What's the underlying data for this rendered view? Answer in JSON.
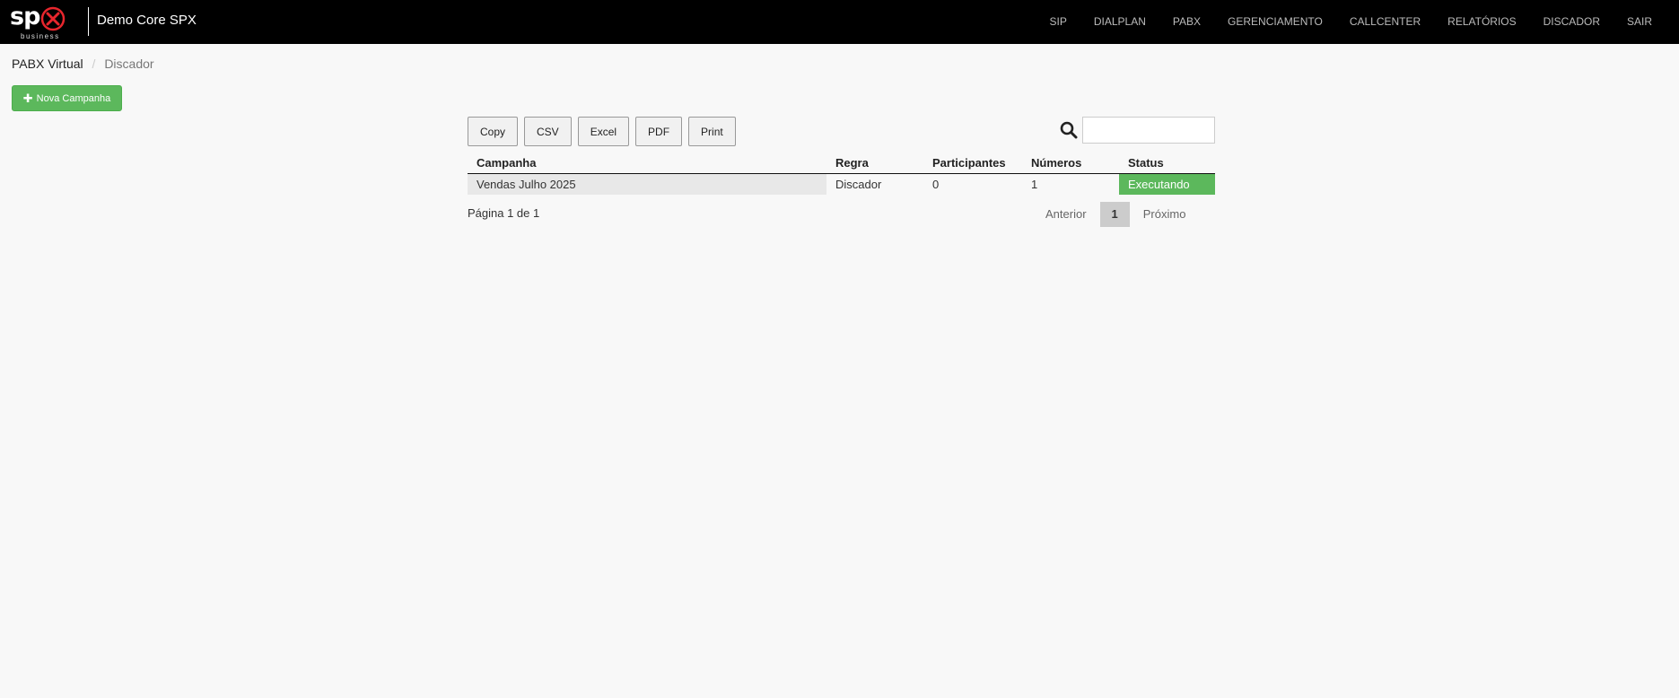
{
  "navbar": {
    "logo_text": "sp",
    "logo_subtext": "business",
    "brand_title": "Demo Core SPX",
    "menu": [
      "SIP",
      "DIALPLAN",
      "PABX",
      "GERENCIAMENTO",
      "CALLCENTER",
      "RELATÓRIOS",
      "DISCADOR",
      "SAIR"
    ],
    "colors": {
      "background": "#000000",
      "logo_accent": "#e8262d"
    }
  },
  "breadcrumb": {
    "parent": "PABX Virtual",
    "separator": "/",
    "current": "Discador"
  },
  "actions": {
    "new_campaign_label": "Nova Campanha",
    "new_campaign_icon": "plus-icon"
  },
  "export_buttons": [
    "Copy",
    "CSV",
    "Excel",
    "PDF",
    "Print"
  ],
  "search": {
    "icon": "search-icon",
    "value": "",
    "placeholder": ""
  },
  "table": {
    "columns": [
      "Campanha",
      "Regra",
      "Participantes",
      "Números",
      "Status"
    ],
    "rows": [
      [
        "Vendas Julho 2025",
        "Discador",
        "0",
        "1",
        "Executando"
      ]
    ],
    "status_color": "#5cb85c"
  },
  "footer": {
    "page_info": "Página 1 de 1",
    "prev_label": "Anterior",
    "current_page": "1",
    "next_label": "Próximo"
  }
}
